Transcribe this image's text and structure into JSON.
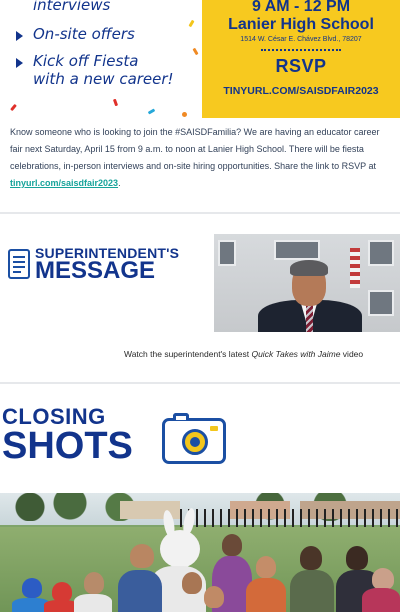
{
  "banner": {
    "bullets": [
      "interviews",
      "On-site offers",
      "Kick off Fiesta",
      "with a new career!"
    ],
    "time": "9 AM - 12 PM",
    "school": "Lanier High School",
    "address": "1514 W. César E. Chávez Blvd., 78207",
    "rsvp": "RSVP",
    "link": "TINYURL.COM/SAISDFAIR2023",
    "colors": {
      "navy": "#12348c",
      "gold": "#f7c91f",
      "red": "#e0302a"
    }
  },
  "paragraph": {
    "text": "Know someone who is looking to join the #SAISDFamilia? We are having an educator career fair next Saturday, April 15 from 9 a.m. to noon at Lanier High School. There will be fiesta celebrations, in-person interviews and on-site hiring opportunities. Share the link to RSVP at ",
    "link": "tinyurl.com/saisdfair2023",
    "end": "."
  },
  "superintendent": {
    "line1": "SUPERINTENDENT'S",
    "line2": "MESSAGE",
    "icon": "document-icon",
    "caption_pre": "Watch the superintendent's latest ",
    "caption_em": "Quick Takes with Jaime",
    "caption_post": " video"
  },
  "closing": {
    "line1": "CLOSING",
    "line2": "SHOTS",
    "icon": "camera-icon"
  }
}
